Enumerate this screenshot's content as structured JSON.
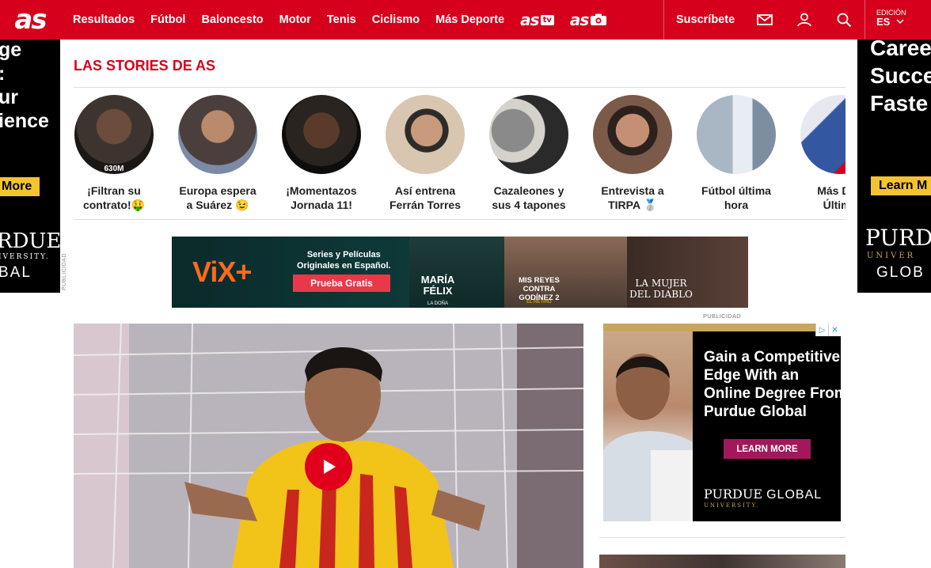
{
  "nav": {
    "logo": "as",
    "items": [
      "Resultados",
      "Fútbol",
      "Baloncesto",
      "Motor",
      "Tenis",
      "Ciclismo",
      "Más Deporte"
    ],
    "brand_tv": "as",
    "brand_tv_sub": "tv",
    "brand_photo": "as",
    "subscribe": "Suscríbete",
    "edition_label": "EDICIÓN",
    "edition_code": "ES"
  },
  "side_ad_left": {
    "lines": [
      "ge",
      ":",
      "ur",
      "ience"
    ],
    "button": "More",
    "logo_top": "RDUE",
    "logo_mid": "IVERSITY.",
    "logo_bot": "BAL"
  },
  "side_ad_right": {
    "lines": [
      "Caree",
      "Succe",
      "Faste"
    ],
    "button": "Learn M",
    "logo_top": "PURD",
    "logo_mid": "UNIVER",
    "logo_bot": "GLOB"
  },
  "side_ad_label": "PUBLICIDAD",
  "stories": {
    "title": "LAS STORIES DE AS",
    "items": [
      {
        "label": "¡Filtran su contrato!🤑",
        "count": "630M"
      },
      {
        "label": "Europa espera a Suárez 😉",
        "count": ""
      },
      {
        "label": "¡Momentazos Jornada 11!",
        "count": ""
      },
      {
        "label": "Así entrena Ferrán Torres",
        "count": ""
      },
      {
        "label": "Cazaleones y sus 4 tapones",
        "count": ""
      },
      {
        "label": "Entrevista a TIRPA 🥈",
        "count": ""
      },
      {
        "label": "Fútbol última hora",
        "count": ""
      },
      {
        "label": "Más Dep Última",
        "count": ""
      }
    ],
    "colors": [
      "#3d3430",
      "#4b3f3e",
      "#2a2420",
      "#d9c6b0",
      "#d5d1cb",
      "#7b5a4a",
      "#a9b6c4",
      "#3457a1"
    ]
  },
  "banner_ad": {
    "logo": "ViX+",
    "tagline_1": "Series y Películas",
    "tagline_2": "Originales en Español.",
    "button": "Prueba Gratis",
    "title_1": "MARÍA FÉLIX",
    "title_1_sub": "LA DOÑA",
    "title_2": "MIS REYES CONTRA GODÍNEZ 2",
    "title_2_sub": "EL RETIRO",
    "title_3": "LA MUJER DEL DIABLO"
  },
  "right_ad": {
    "label": "PUBLICIDAD",
    "headline": [
      "Gain a Competitive",
      "Edge With an",
      "Online Degree From",
      "Purdue Global"
    ],
    "button": "LEARN MORE",
    "logo_a": "PURDUE",
    "logo_b": "GLOBAL",
    "logo_sub": "UNIVERSITY."
  },
  "colors": {
    "brand_red": "#d6001c",
    "play_red": "#e0001b",
    "ad_yellow": "#f4c430",
    "purdue_magenta": "#a2185b",
    "vix_orange": "#ff6a1a"
  }
}
